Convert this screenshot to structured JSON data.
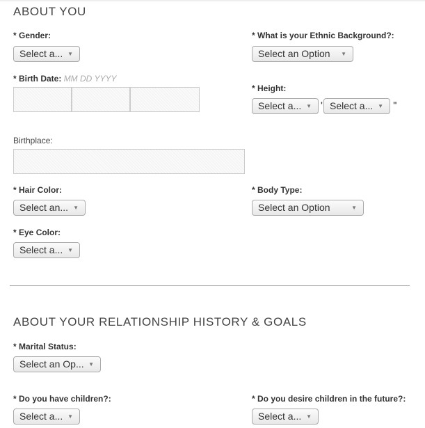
{
  "section1": {
    "title": "ABOUT YOU",
    "gender": {
      "label": "* Gender:",
      "value": "Select a..."
    },
    "ethnic": {
      "label": "* What is your Ethnic Background?:",
      "value": "Select an Option"
    },
    "birth_date": {
      "label": "* Birth Date:",
      "hint": "MM DD YYYY",
      "month": "",
      "day": "",
      "year": ""
    },
    "height": {
      "label": "* Height:",
      "feet": "Select a...",
      "inches": "Select a...",
      "feet_mark": "'",
      "inches_mark": "\""
    },
    "birthplace": {
      "label": "Birthplace:",
      "value": ""
    },
    "hair_color": {
      "label": "* Hair Color:",
      "value": "Select an..."
    },
    "body_type": {
      "label": "* Body Type:",
      "value": "Select an Option"
    },
    "eye_color": {
      "label": "* Eye Color:",
      "value": "Select a..."
    }
  },
  "section2": {
    "title": "ABOUT YOUR RELATIONSHIP HISTORY & GOALS",
    "marital_status": {
      "label": "* Marital Status:",
      "value": "Select an Op..."
    },
    "have_children": {
      "label": "* Do you have children?:",
      "value": "Select a..."
    },
    "desire_children": {
      "label": "* Do you desire children in the future?:",
      "value": "Select a..."
    }
  },
  "icons": {
    "dropdown_arrow": "▼"
  }
}
